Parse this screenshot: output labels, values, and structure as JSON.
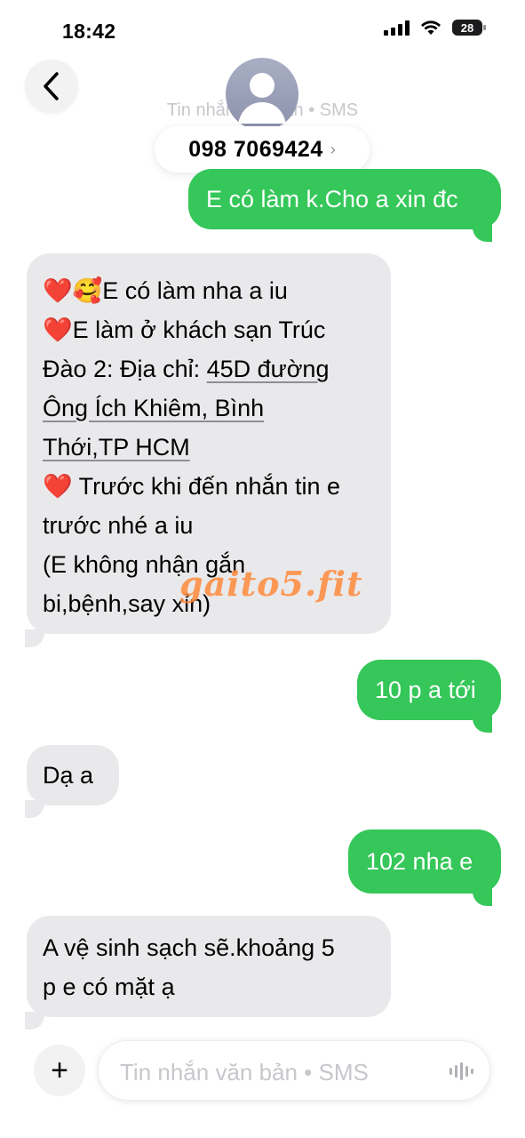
{
  "status_bar": {
    "time": "18:42",
    "battery": "28"
  },
  "header": {
    "subtitle": "Tin nhắn văn bản • SMS",
    "contact": "098 7069424",
    "chevron": "›"
  },
  "messages": [
    {
      "dir": "out",
      "text": "E có làm k.Cho a xin đc"
    },
    {
      "dir": "in",
      "lines": [
        "❤️🥰E có làm nha a iu",
        "❤️E làm ở khách sạn Trúc",
        "Đào 2: Địa chỉ: ",
        "45D đường",
        "Ông Ích Khiêm, Bình",
        "Thới,TP HCM",
        "❤️ Trước khi đến nhắn tin e",
        "trước nhé a iu",
        "(E không nhận gắn",
        "bi,bệnh,say xỉn)"
      ]
    },
    {
      "dir": "out",
      "text": "10 p a tới"
    },
    {
      "dir": "in",
      "text": "Dạ a"
    },
    {
      "dir": "out",
      "text": "102 nha e"
    },
    {
      "dir": "in",
      "lines": [
        "A vệ sinh sạch sẽ.khoảng 5",
        "p e có mặt ạ"
      ]
    }
  ],
  "watermark": "gaito5.fit",
  "composer": {
    "placeholder": "Tin nhắn văn bản • SMS",
    "plus": "+"
  }
}
